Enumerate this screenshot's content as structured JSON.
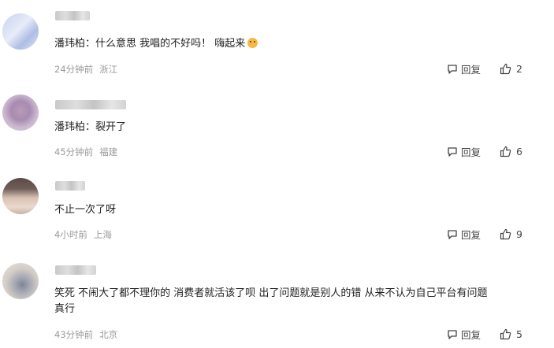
{
  "comments": [
    {
      "text": "潘玮柏：什么意思 我唱的不好吗！ 嗨起来",
      "emoji": "party-face-emoji",
      "time": "24分钟前",
      "location": "浙江",
      "reply_label": "回复",
      "likes": "2"
    },
    {
      "text": "潘玮柏：裂开了",
      "time": "45分钟前",
      "location": "福建",
      "reply_label": "回复",
      "likes": "6"
    },
    {
      "text": "不止一次了呀",
      "time": "4小时前",
      "location": "上海",
      "reply_label": "回复",
      "likes": "9"
    },
    {
      "text": "笑死 不闹大了都不理你的 消费者就活该了呗 出了问题就是别人的错 从来不认为自己平台有问题\n真行",
      "time": "43分钟前",
      "location": "北京",
      "reply_label": "回复",
      "likes": "5"
    }
  ]
}
